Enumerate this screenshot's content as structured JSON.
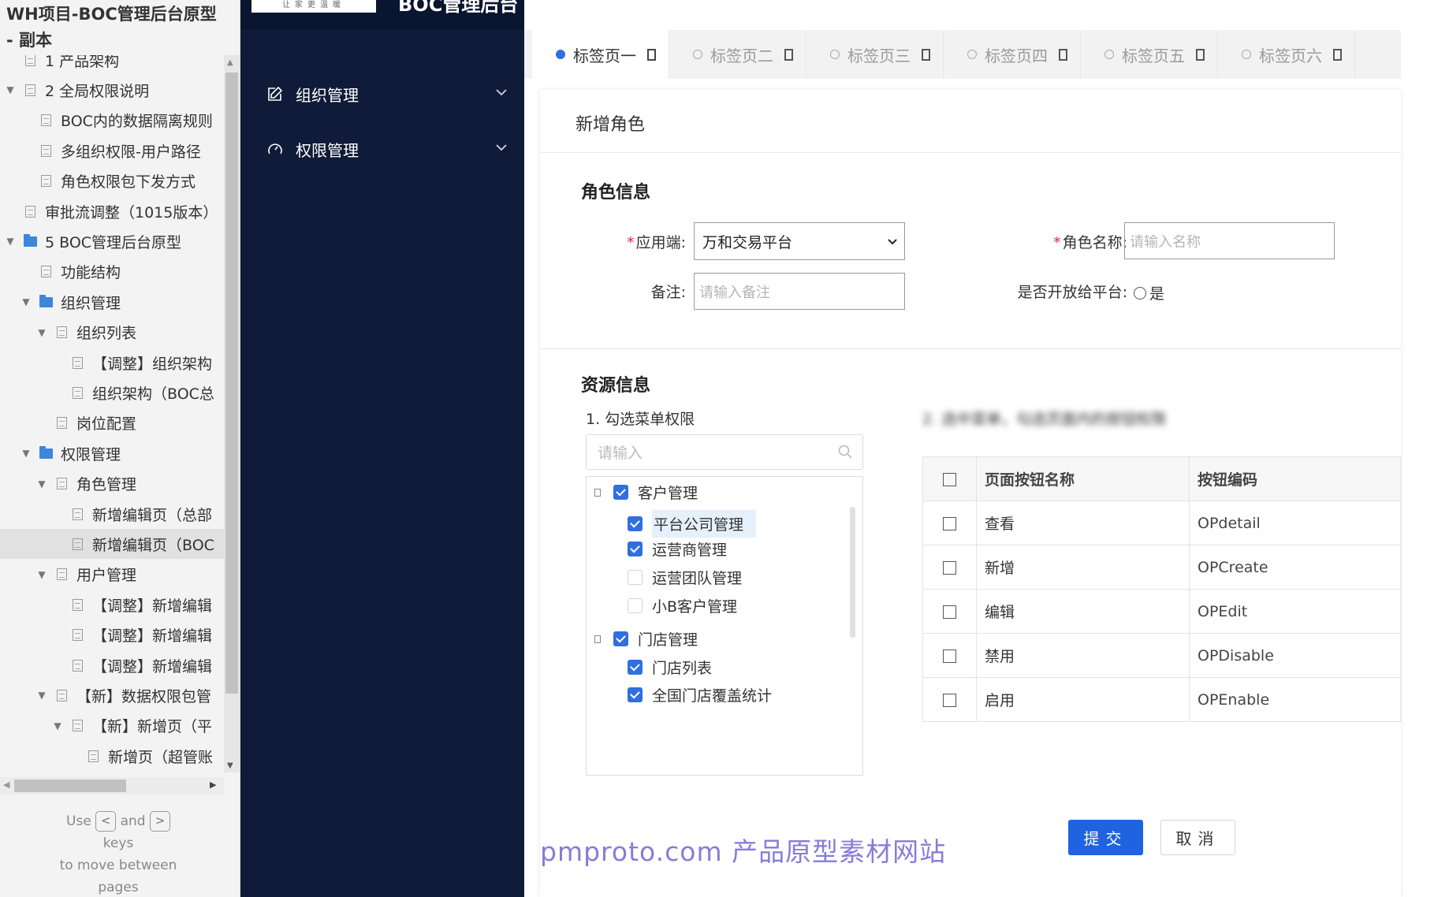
{
  "page_tree": {
    "title": "WH项目-BOC管理后台原型 - 副本",
    "items": [
      {
        "label": "1 产品架构",
        "indent": 0,
        "arrow": "",
        "icon": "page"
      },
      {
        "label": "2 全局权限说明",
        "indent": 0,
        "arrow": "▼",
        "icon": "page"
      },
      {
        "label": "BOC内的数据隔离规则",
        "indent": 1,
        "arrow": "",
        "icon": "page"
      },
      {
        "label": "多组织权限-用户路径",
        "indent": 1,
        "arrow": "",
        "icon": "page"
      },
      {
        "label": "角色权限包下发方式",
        "indent": 1,
        "arrow": "",
        "icon": "page"
      },
      {
        "label": "审批流调整（1015版本）",
        "indent": 0,
        "arrow": "",
        "icon": "page"
      },
      {
        "label": "5 BOC管理后台原型",
        "indent": 0,
        "arrow": "▼",
        "icon": "folder"
      },
      {
        "label": "功能结构",
        "indent": 1,
        "arrow": "",
        "icon": "page"
      },
      {
        "label": "组织管理",
        "indent": 1,
        "arrow": "▼",
        "icon": "folder"
      },
      {
        "label": "组织列表",
        "indent": 2,
        "arrow": "▼",
        "icon": "page"
      },
      {
        "label": "【调整】组织架构",
        "indent": 3,
        "arrow": "",
        "icon": "page"
      },
      {
        "label": "组织架构（BOC总",
        "indent": 3,
        "arrow": "",
        "icon": "page"
      },
      {
        "label": "岗位配置",
        "indent": 2,
        "arrow": "",
        "icon": "page"
      },
      {
        "label": "权限管理",
        "indent": 1,
        "arrow": "▼",
        "icon": "folder"
      },
      {
        "label": "角色管理",
        "indent": 2,
        "arrow": "▼",
        "icon": "page"
      },
      {
        "label": "新增编辑页（总部",
        "indent": 3,
        "arrow": "",
        "icon": "page"
      },
      {
        "label": "新增编辑页（BOC",
        "indent": 3,
        "arrow": "",
        "icon": "page",
        "selected": true
      },
      {
        "label": "用户管理",
        "indent": 2,
        "arrow": "▼",
        "icon": "page"
      },
      {
        "label": "【调整】新增编辑",
        "indent": 3,
        "arrow": "",
        "icon": "page"
      },
      {
        "label": "【调整】新增编辑",
        "indent": 3,
        "arrow": "",
        "icon": "page"
      },
      {
        "label": "【调整】新增编辑",
        "indent": 3,
        "arrow": "",
        "icon": "page"
      },
      {
        "label": "【新】数据权限包管",
        "indent": 2,
        "arrow": "▼",
        "icon": "page"
      },
      {
        "label": "【新】新增页（平",
        "indent": 3,
        "arrow": "▼",
        "icon": "page"
      },
      {
        "label": "新增页（超管账",
        "indent": 4,
        "arrow": "",
        "icon": "page"
      }
    ],
    "help": {
      "use": "Use",
      "and": "and",
      "keys": "keys",
      "move": "to move between",
      "pages": "pages",
      "prev_key": "<",
      "next_key": ">"
    }
  },
  "nav": {
    "logo_text": "让家更温暖",
    "app_title": "BOC管理后台",
    "items": [
      {
        "label": "组织管理",
        "icon": "edit-icon"
      },
      {
        "label": "权限管理",
        "icon": "gauge-icon"
      }
    ]
  },
  "tabs": [
    {
      "label": "标签页一",
      "active": true
    },
    {
      "label": "标签页二",
      "active": false
    },
    {
      "label": "标签页三",
      "active": false
    },
    {
      "label": "标签页四",
      "active": false
    },
    {
      "label": "标签页五",
      "active": false
    },
    {
      "label": "标签页六",
      "active": false
    }
  ],
  "form": {
    "card_title": "新增角色",
    "role_section": "角色信息",
    "app_label": "应用端:",
    "app_value": "万和交易平台",
    "role_name_label": "角色名称:",
    "role_name_placeholder": "请输入名称",
    "remark_label": "备注:",
    "remark_placeholder": "请输入备注",
    "open_label": "是否开放给平台:",
    "open_option": "是",
    "required_mark": "*"
  },
  "resources": {
    "section": "资源信息",
    "step1": "1. 勾选菜单权限",
    "step2": "2. 选中菜单，勾选页面内的按钮权限",
    "search_placeholder": "请输入",
    "tree": [
      {
        "label": "客户管理",
        "level": 0,
        "checked": true
      },
      {
        "label": "平台公司管理",
        "level": 1,
        "checked": true,
        "highlight": true
      },
      {
        "label": "运营商管理",
        "level": 1,
        "checked": true
      },
      {
        "label": "运营团队管理",
        "level": 1,
        "checked": false
      },
      {
        "label": "小B客户管理",
        "level": 1,
        "checked": false
      },
      {
        "label": "门店管理",
        "level": 0,
        "checked": true
      },
      {
        "label": "门店列表",
        "level": 1,
        "checked": true
      },
      {
        "label": "全国门店覆盖统计",
        "level": 1,
        "checked": true
      }
    ],
    "table": {
      "headers": [
        "页面按钮名称",
        "按钮编码"
      ],
      "rows": [
        {
          "name": "查看",
          "code": "OPdetail"
        },
        {
          "name": "新增",
          "code": "OPCreate"
        },
        {
          "name": "编辑",
          "code": "OPEdit"
        },
        {
          "name": "禁用",
          "code": "OPDisable"
        },
        {
          "name": "启用",
          "code": "OPEnable"
        }
      ]
    }
  },
  "actions": {
    "submit": "提交",
    "cancel": "取消"
  },
  "watermark": "pmproto.com 产品原型素材网站",
  "colors": {
    "nav_bg": "#0f1b38",
    "primary": "#1f63e0",
    "required": "#e23333"
  }
}
